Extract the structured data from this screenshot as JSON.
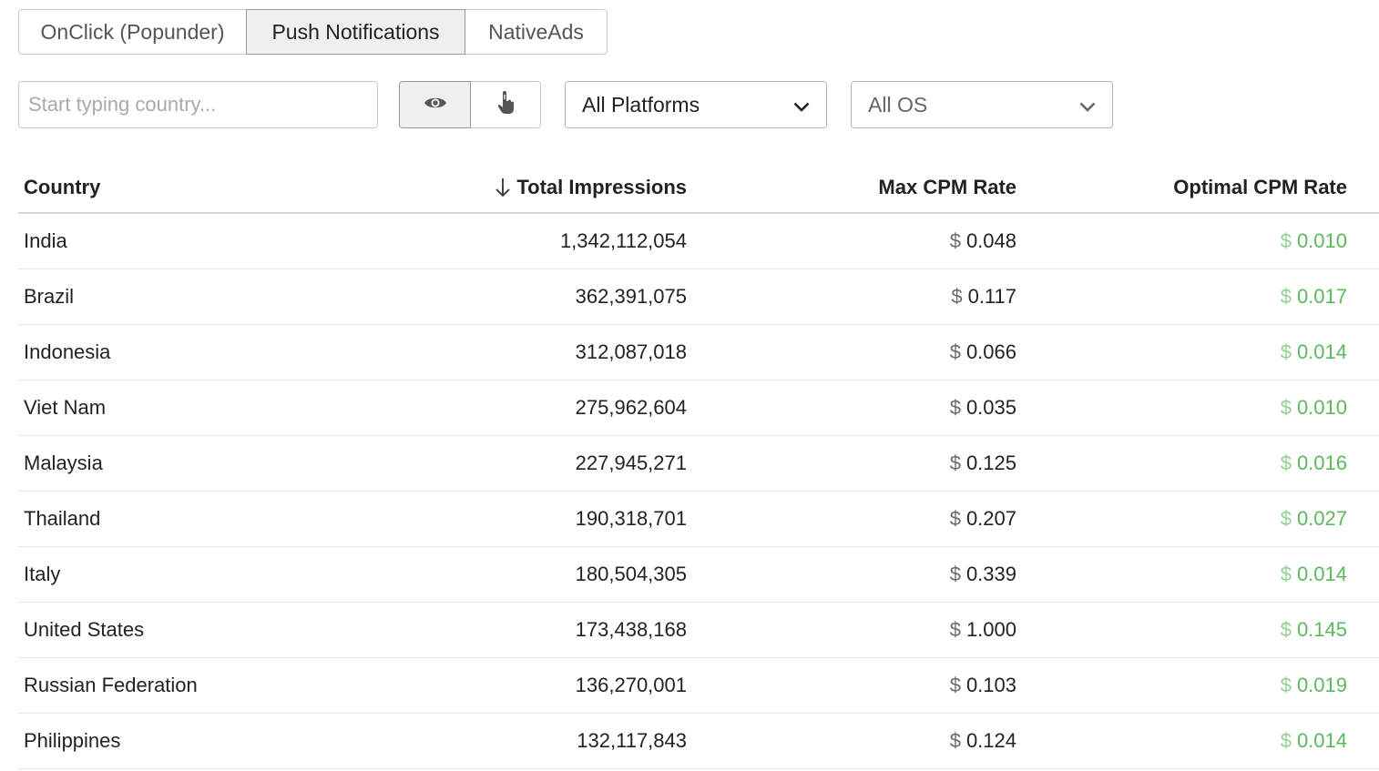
{
  "tabs": [
    {
      "label": "OnClick (Popunder)"
    },
    {
      "label": "Push Notifications"
    },
    {
      "label": "NativeAds"
    }
  ],
  "active_tab": "Push Notifications",
  "search": {
    "placeholder": "Start typing country..."
  },
  "toggle": {
    "icons": [
      "eye-icon",
      "pointer-hand-icon"
    ]
  },
  "platform_select": {
    "value": "All Platforms"
  },
  "os_select": {
    "value": "All OS"
  },
  "table": {
    "headers": {
      "country": "Country",
      "impressions": "Total Impressions",
      "max_cpm": "Max CPM Rate",
      "optimal_cpm": "Optimal CPM Rate"
    },
    "currency": "$",
    "rows": [
      {
        "country": "India",
        "impressions": "1,342,112,054",
        "max_cpm": "0.048",
        "optimal_cpm": "0.010"
      },
      {
        "country": "Brazil",
        "impressions": "362,391,075",
        "max_cpm": "0.117",
        "optimal_cpm": "0.017"
      },
      {
        "country": "Indonesia",
        "impressions": "312,087,018",
        "max_cpm": "0.066",
        "optimal_cpm": "0.014"
      },
      {
        "country": "Viet Nam",
        "impressions": "275,962,604",
        "max_cpm": "0.035",
        "optimal_cpm": "0.010"
      },
      {
        "country": "Malaysia",
        "impressions": "227,945,271",
        "max_cpm": "0.125",
        "optimal_cpm": "0.016"
      },
      {
        "country": "Thailand",
        "impressions": "190,318,701",
        "max_cpm": "0.207",
        "optimal_cpm": "0.027"
      },
      {
        "country": "Italy",
        "impressions": "180,504,305",
        "max_cpm": "0.339",
        "optimal_cpm": "0.014"
      },
      {
        "country": "United States",
        "impressions": "173,438,168",
        "max_cpm": "1.000",
        "optimal_cpm": "0.145"
      },
      {
        "country": "Russian Federation",
        "impressions": "136,270,001",
        "max_cpm": "0.103",
        "optimal_cpm": "0.019"
      },
      {
        "country": "Philippines",
        "impressions": "132,117,843",
        "max_cpm": "0.124",
        "optimal_cpm": "0.014"
      }
    ]
  },
  "colors": {
    "optimal_green": "#5cb85c",
    "active_tab_bg": "#efefef",
    "border": "#c8c8c8"
  }
}
